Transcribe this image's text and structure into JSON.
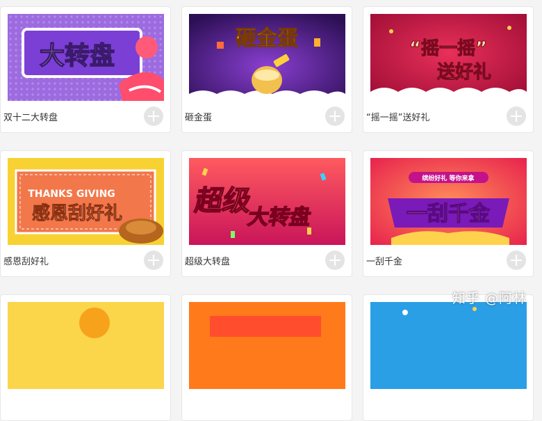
{
  "cards": [
    {
      "title": "双十二大转盘",
      "banner_text": "大转盘"
    },
    {
      "title": "砸金蛋",
      "banner_text": "砸金蛋"
    },
    {
      "title": "“摇一摇”送好礼",
      "banner_line1": "“摇一摇”",
      "banner_line2": "送好礼"
    },
    {
      "title": "感恩刮好礼",
      "banner_line1": "THANKS GIVING",
      "banner_line2": "感恩刮好礼"
    },
    {
      "title": "超级大转盘",
      "banner_line1": "超级",
      "banner_line2": "大转盘"
    },
    {
      "title": "一刮千金",
      "banner_top": "缤纷好礼 等你来拿",
      "banner_text": "一刮千金"
    }
  ],
  "watermark": "知乎 @阿林",
  "colors": {
    "page_bg": "#f4f4f4",
    "add_button": "#e4e4e4"
  }
}
